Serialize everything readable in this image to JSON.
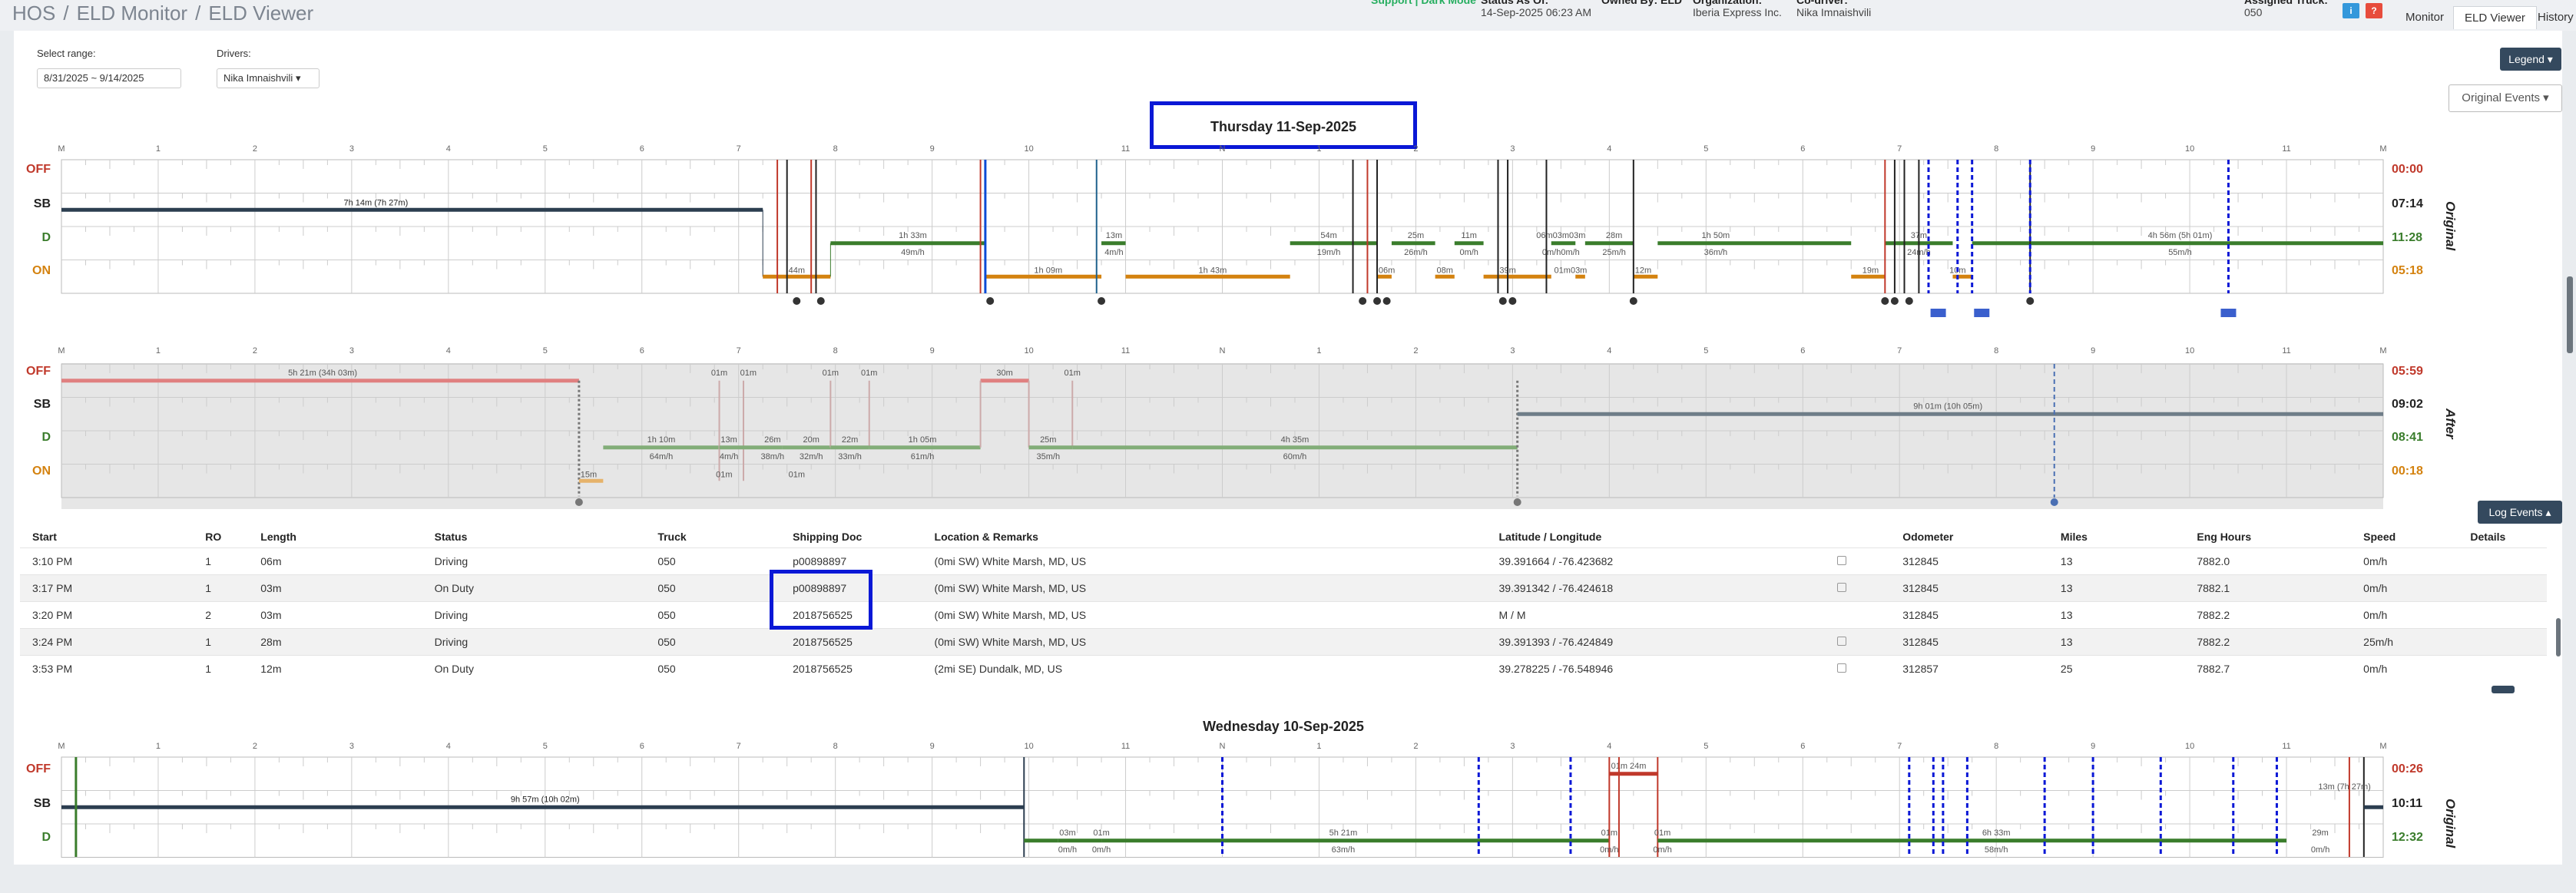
{
  "breadcrumb": {
    "root": "HOS",
    "mid": "ELD Monitor",
    "current": "ELD Viewer"
  },
  "topinfo": {
    "support_clip": "Support | Dark Mode",
    "date_clip": "Status As Of:",
    "date": "14-Sep-2025 06:23 AM",
    "owned_clip": "Owned By: ELD",
    "org_clip": "Organization:",
    "org": "Iberia Express Inc.",
    "driver_clip": "Co-driver:",
    "driver": "Nika Imnaishvili",
    "truck_clip": "Assigned Truck:",
    "truck": "050",
    "help_badge": "?",
    "info_badge": "i"
  },
  "tabs": [
    "Monitor",
    "ELD Viewer",
    "History"
  ],
  "filters": {
    "range_label": "Select range:",
    "range_value": "8/31/2025 ~ 9/14/2025",
    "drivers_label": "Drivers:",
    "driver_value": "Nika Imnaishvili"
  },
  "buttons": {
    "legend": "Legend",
    "original_events": "Original Events",
    "log_events": "Log Events"
  },
  "day1": {
    "title": "Thursday 11-Sep-2025",
    "side_original": "Original",
    "side_after": "After",
    "original_totals": {
      "off": "00:00",
      "sb": "07:14",
      "d": "11:28",
      "on": "05:18"
    },
    "after_totals": {
      "off": "05:59",
      "sb": "09:02",
      "d": "08:41",
      "on": "00:18"
    }
  },
  "day2": {
    "title": "Wednesday 10-Sep-2025",
    "side_original": "Original",
    "original_totals": {
      "off": "00:26",
      "sb": "10:11",
      "d": "12:32"
    }
  },
  "row_labels": {
    "off": "OFF",
    "sb": "SB",
    "d": "D",
    "on": "ON"
  },
  "hour_labels": [
    "M",
    "1",
    "2",
    "3",
    "4",
    "5",
    "6",
    "7",
    "8",
    "9",
    "10",
    "11",
    "N",
    "1",
    "2",
    "3",
    "4",
    "5",
    "6",
    "7",
    "8",
    "9",
    "10",
    "11",
    "M"
  ],
  "original_segments": {
    "sb1": "7h 14m (7h 27m)",
    "on1": "44m",
    "d1": "1h 33m",
    "d1s": "49m/h",
    "on2": "1h 09m",
    "d2": "13m",
    "d2s": "4m/h",
    "on3": "1h 43m",
    "d3": "54m",
    "d3s": "19m/h",
    "on4": "06m",
    "d4": "25m",
    "d4s": "26m/h",
    "on5": "08m",
    "d5": "11m",
    "d5s": "0m/h",
    "on6": "39m",
    "d6": "06m03m03m",
    "d6s": "0m/h0m/h",
    "on7": "01m03m",
    "d7": "28m",
    "d7s": "25m/h",
    "on8": "12m",
    "d8": "1h 50m",
    "d8s": "36m/h",
    "on9": "19m",
    "d9": "37m",
    "d9s": "24m/h",
    "on10": "10m",
    "d10": "4h 56m (5h 01m)",
    "d10s": "55m/h"
  },
  "after_segments": {
    "off1": "5h 21m (34h 03m)",
    "on1": "15m",
    "d1": "1h 10m",
    "d1s": "64m/h",
    "off2": "01m",
    "off3": "01m",
    "d2": "13m",
    "d2s": "4m/h",
    "d3": "26m",
    "d3s": "38m/h",
    "on2": "01m",
    "d4": "20m",
    "d4s": "32m/h",
    "on3": "01m",
    "off4": "01m",
    "off5": "01m",
    "d5": "22m",
    "d5s": "33m/h",
    "d6": "1h 05m",
    "d6s": "61m/h",
    "off6": "30m",
    "off7": "01m",
    "d7": "25m",
    "d7s": "35m/h",
    "d8": "4h 35m",
    "d8s": "60m/h",
    "sb1": "9h 01m (10h 05m)"
  },
  "day2_segments": {
    "sb1": "9h 57m (10h 02m)",
    "d1": "03m",
    "d1s": "0m/h",
    "d2": "01m",
    "d2s": "0m/h",
    "d3": "5h 21m",
    "d3s": "63m/h",
    "off1": "01m 24m",
    "d4": "01m",
    "d4s": "0m/h",
    "d5": "01m",
    "d5s": "0m/h",
    "d6": "6h 33m",
    "d6s": "58m/h",
    "d7": "29m",
    "d7s": "0m/h",
    "sb2": "13m (7h 27m)"
  },
  "table": {
    "headers": [
      "Start",
      "RO",
      "Length",
      "Status",
      "Truck",
      "Shipping Doc",
      "Location & Remarks",
      "Latitude / Longitude",
      "",
      "Odometer",
      "Miles",
      "Eng Hours",
      "Speed",
      "Details"
    ],
    "rows": [
      {
        "start": "3:10 PM",
        "ro": "1",
        "length": "06m",
        "status": "Driving",
        "truck": "050",
        "doc": "p00898897",
        "loc": "(0mi SW) White Marsh, MD, US",
        "latlng": "39.391664 / -76.423682",
        "odo": "312845",
        "miles": "13",
        "eng": "7882.0",
        "speed": "0m/h"
      },
      {
        "start": "3:17 PM",
        "ro": "1",
        "length": "03m",
        "status": "On Duty",
        "truck": "050",
        "doc": "p00898897",
        "loc": "(0mi SW) White Marsh, MD, US",
        "latlng": "39.391342 / -76.424618",
        "odo": "312845",
        "miles": "13",
        "eng": "7882.1",
        "speed": "0m/h"
      },
      {
        "start": "3:20 PM",
        "ro": "2",
        "length": "03m",
        "status": "Driving",
        "truck": "050",
        "doc": "2018756525",
        "loc": "(0mi SW) White Marsh, MD, US",
        "latlng": "M / M",
        "odo": "312845",
        "miles": "13",
        "eng": "7882.2",
        "speed": "0m/h"
      },
      {
        "start": "3:24 PM",
        "ro": "1",
        "length": "28m",
        "status": "Driving",
        "truck": "050",
        "doc": "2018756525",
        "loc": "(0mi SW) White Marsh, MD, US",
        "latlng": "39.391393 / -76.424849",
        "odo": "312845",
        "miles": "13",
        "eng": "7882.2",
        "speed": "25m/h"
      },
      {
        "start": "3:53 PM",
        "ro": "1",
        "length": "12m",
        "status": "On Duty",
        "truck": "050",
        "doc": "2018756525",
        "loc": "(2mi SE) Dundalk, MD, US",
        "latlng": "39.278225 / -76.548946",
        "odo": "312857",
        "miles": "25",
        "eng": "7882.7",
        "speed": "0m/h"
      }
    ]
  },
  "colors": {
    "off": "#c0392b",
    "sb": "#2c3e50",
    "d": "#3a7d2c",
    "on": "#d4820f",
    "highlight": "#0a18d6"
  }
}
